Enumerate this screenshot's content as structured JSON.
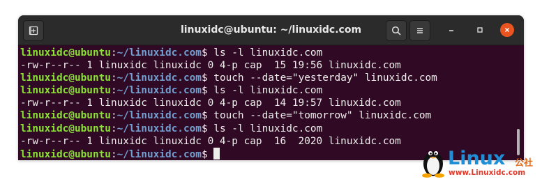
{
  "window": {
    "title": "linuxidc@ubuntu: ~/linuxidc.com",
    "controls": {
      "minimize_icon": "minimize-icon",
      "maximize_icon": "maximize-icon",
      "close_icon": "close-icon"
    },
    "toolbar": {
      "new_tab_icon": "new-tab-icon",
      "search_icon": "search-icon",
      "menu_icon": "hamburger-menu-icon"
    }
  },
  "terminal": {
    "background": "#300a24",
    "prompt": {
      "user_host": "linuxidc@ubuntu",
      "colon": ":",
      "path": "~/linuxidc.com",
      "symbol": "$"
    },
    "lines": [
      {
        "type": "prompt",
        "command": "ls -l linuxidc.com"
      },
      {
        "type": "output",
        "text": "-rw-r--r-- 1 linuxidc linuxidc 0 4-p cap  15 19:56 linuxidc.com"
      },
      {
        "type": "prompt",
        "command": "touch --date=\"yesterday\" linuxidc.com"
      },
      {
        "type": "prompt",
        "command": "ls -l linuxidc.com"
      },
      {
        "type": "output",
        "text": "-rw-r--r-- 1 linuxidc linuxidc 0 4-p cap  14 19:57 linuxidc.com"
      },
      {
        "type": "prompt",
        "command": "touch --date=\"tomorrow\" linuxidc.com"
      },
      {
        "type": "prompt",
        "command": "ls -l linuxidc.com"
      },
      {
        "type": "output",
        "text": "-rw-r--r-- 1 linuxidc linuxidc 0 4-p cap  16  2020 linuxidc.com"
      },
      {
        "type": "prompt",
        "command": "",
        "cursor": true
      }
    ]
  },
  "watermark": {
    "brand": "Linux",
    "brand_cn": "公社",
    "url": "www.Linuxidc.com",
    "logo_icon": "tux-penguin-icon"
  }
}
